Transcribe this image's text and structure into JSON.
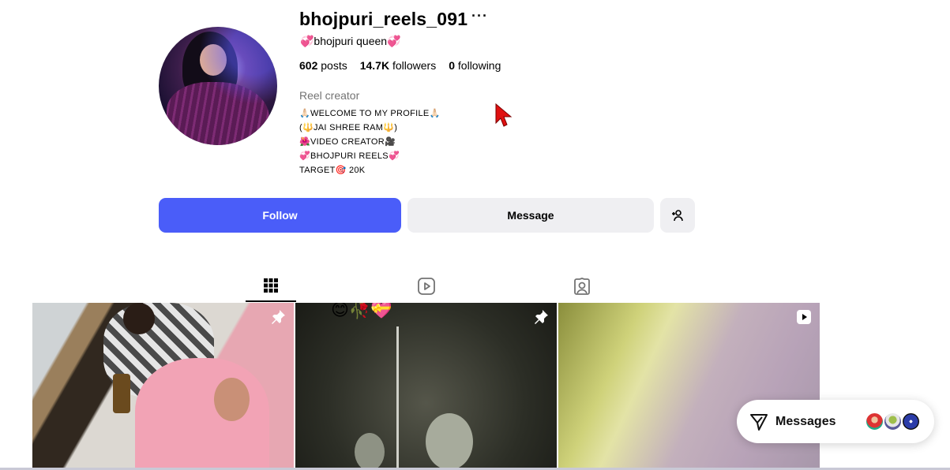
{
  "profile": {
    "username": "bhojpuri_reels_091",
    "more_glyph": "···",
    "full_name": "💞bhojpuri queen💞",
    "stats": {
      "posts_count": "602",
      "posts_label": "posts",
      "followers_count": "14.7K",
      "followers_label": "followers",
      "following_count": "0",
      "following_label": "following"
    },
    "category": "Reel creator",
    "bio": [
      "🙏🏻WELCOME TO MY PROFILE🙏🏻",
      "(🔱JAI SHREE RAM🔱)",
      "🌺VIDEO CREATOR🎥",
      "💞BHOJPURI REELS💞",
      "TARGET🎯  20k"
    ]
  },
  "actions": {
    "follow_label": "Follow",
    "message_label": "Message",
    "add_icon": "add-person-icon"
  },
  "tabs": [
    {
      "name": "posts",
      "icon": "grid-icon",
      "active": true
    },
    {
      "name": "reels",
      "icon": "reels-icon",
      "active": false
    },
    {
      "name": "tagged",
      "icon": "tagged-icon",
      "active": false
    }
  ],
  "grid": [
    {
      "type": "pinned-post",
      "icon": "pin-icon"
    },
    {
      "type": "pinned-post",
      "icon": "pin-icon",
      "overlay_text": "😊🥀💝"
    },
    {
      "type": "reel",
      "icon": "reel-icon"
    }
  ],
  "messages_widget": {
    "label": "Messages",
    "icon": "send-icon"
  },
  "colors": {
    "follow_button": "#4a5df9",
    "secondary_button": "#efeff2",
    "muted_text": "#737373",
    "cursor": "#e01010"
  }
}
